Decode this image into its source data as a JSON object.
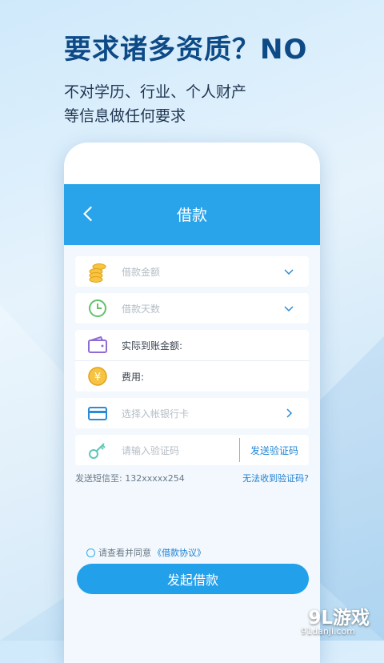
{
  "headline": "要求诸多资质？NO",
  "subline1": "不对学历、行业、个人财产",
  "subline2": "等信息做任何要求",
  "nav": {
    "title": "借款"
  },
  "form": {
    "amount_placeholder": "借款金额",
    "days_placeholder": "借款天数",
    "actual_label": "实际到账金额:",
    "fee_label": "费用:",
    "bank_placeholder": "选择入帐银行卡",
    "code_placeholder": "请输入验证码",
    "send_code": "发送验证码"
  },
  "sms": {
    "info": "发送短信至:  132xxxxx254",
    "help": "无法收到验证码?"
  },
  "agreement": {
    "text": "请查看并同意",
    "link": "《借款协议》"
  },
  "submit_label": "发起借款",
  "watermark": {
    "brand": "9L游戏",
    "domain": "91danji.com"
  },
  "colors": {
    "primary": "#29a3ea",
    "title": "#0d4a86"
  }
}
